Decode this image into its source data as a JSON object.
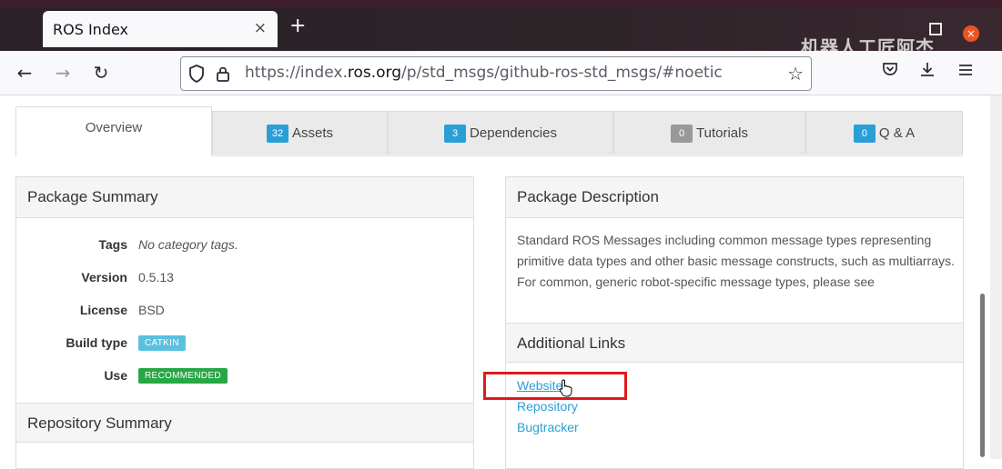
{
  "browser": {
    "tab_title": "ROS Index",
    "tab_close": "×",
    "new_tab": "+",
    "watermark": "机器人工匠阿杰",
    "window_close": "×",
    "url_prefix": "https://index.",
    "url_domain": "ros.org",
    "url_path": "/p/std_msgs/github-ros-std_msgs/#noetic",
    "icons": [
      "back-icon",
      "forward-icon",
      "reload-icon",
      "shield-icon",
      "lock-icon",
      "star-icon",
      "pocket-icon",
      "download-icon",
      "menu-icon"
    ]
  },
  "tabs": [
    {
      "label": "Overview",
      "count": null
    },
    {
      "label": "Assets",
      "count": "32",
      "color": "#2a9fd6"
    },
    {
      "label": "Dependencies",
      "count": "3",
      "color": "#2a9fd6"
    },
    {
      "label": "Tutorials",
      "count": "0",
      "color": "#999999"
    },
    {
      "label": "Q & A",
      "count": "0",
      "color": "#2a9fd6"
    }
  ],
  "summary": {
    "title": "Package Summary",
    "rows": [
      {
        "key": "Tags",
        "value": "No category tags."
      },
      {
        "key": "Version",
        "value": "0.5.13"
      },
      {
        "key": "License",
        "value": "BSD"
      },
      {
        "key": "Build type",
        "value": "CATKIN",
        "color": "#5bc0de"
      },
      {
        "key": "Use",
        "value": "RECOMMENDED",
        "color": "#28a745"
      }
    ],
    "repo_title": "Repository Summary"
  },
  "description": {
    "title": "Package Description",
    "text": "Standard ROS Messages including common message types representing primitive data types and other basic message constructs, such as multiarrays. For common, generic robot-specific message types, please see",
    "links_title": "Additional Links",
    "links": [
      "Website",
      "Repository",
      "Bugtracker"
    ]
  },
  "colors": {
    "accent": "#2a9fd6",
    "highlight": "#e0191c"
  }
}
